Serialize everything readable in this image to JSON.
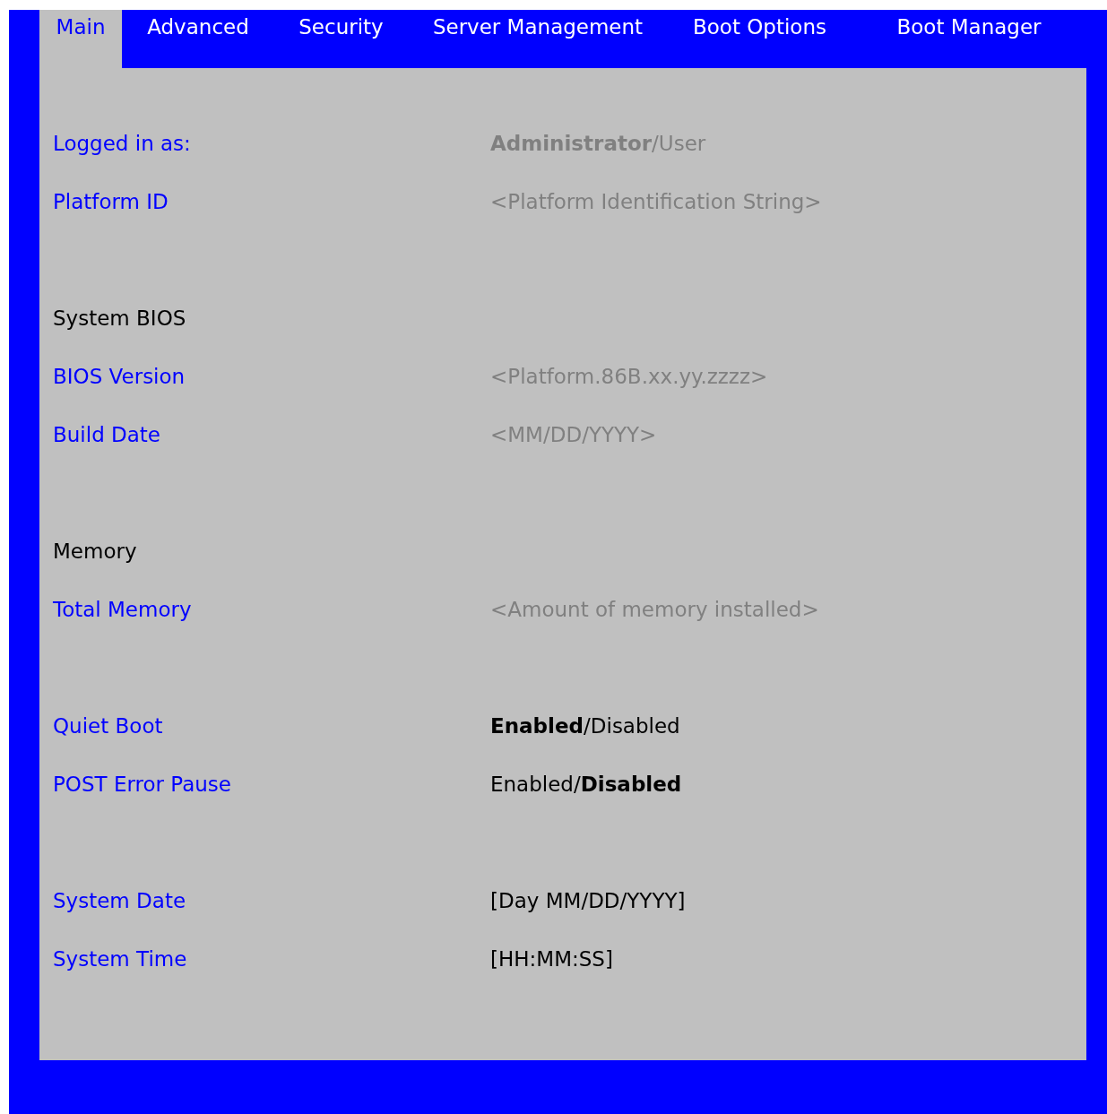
{
  "tabs": [
    {
      "label": "Main",
      "selected": true
    },
    {
      "label": "Advanced",
      "selected": false
    },
    {
      "label": "Security",
      "selected": false
    },
    {
      "label": "Server Management",
      "selected": false
    },
    {
      "label": "Boot Options",
      "selected": false
    },
    {
      "label": "Boot Manager",
      "selected": false
    }
  ],
  "sections": [
    {
      "rows": [
        {
          "label": "Logged in as:",
          "value": "**Administrator**/User",
          "kind": "info"
        },
        {
          "label": "Platform ID",
          "value": "<Platform Identification String>",
          "kind": "info"
        }
      ]
    },
    {
      "heading": "System BIOS",
      "rows": [
        {
          "label": "BIOS Version",
          "value": "<Platform.86B.xx.yy.zzzz>",
          "kind": "info"
        },
        {
          "label": "Build Date",
          "value": "<MM/DD/YYYY>",
          "kind": "info"
        }
      ]
    },
    {
      "heading": "Memory",
      "rows": [
        {
          "label": "Total Memory",
          "value": "<Amount of memory installed>",
          "kind": "info"
        }
      ]
    },
    {
      "rows": [
        {
          "label": "Quiet Boot",
          "value": "**Enabled**/Disabled",
          "kind": "option"
        },
        {
          "label": "POST Error Pause",
          "value": "Enabled/**Disabled**",
          "kind": "option"
        }
      ]
    },
    {
      "rows": [
        {
          "label": "System Date",
          "value": "[Day MM/DD/YYYY]",
          "kind": "input"
        },
        {
          "label": "System Time",
          "value": "[HH:MM:SS]",
          "kind": "input"
        }
      ]
    }
  ]
}
